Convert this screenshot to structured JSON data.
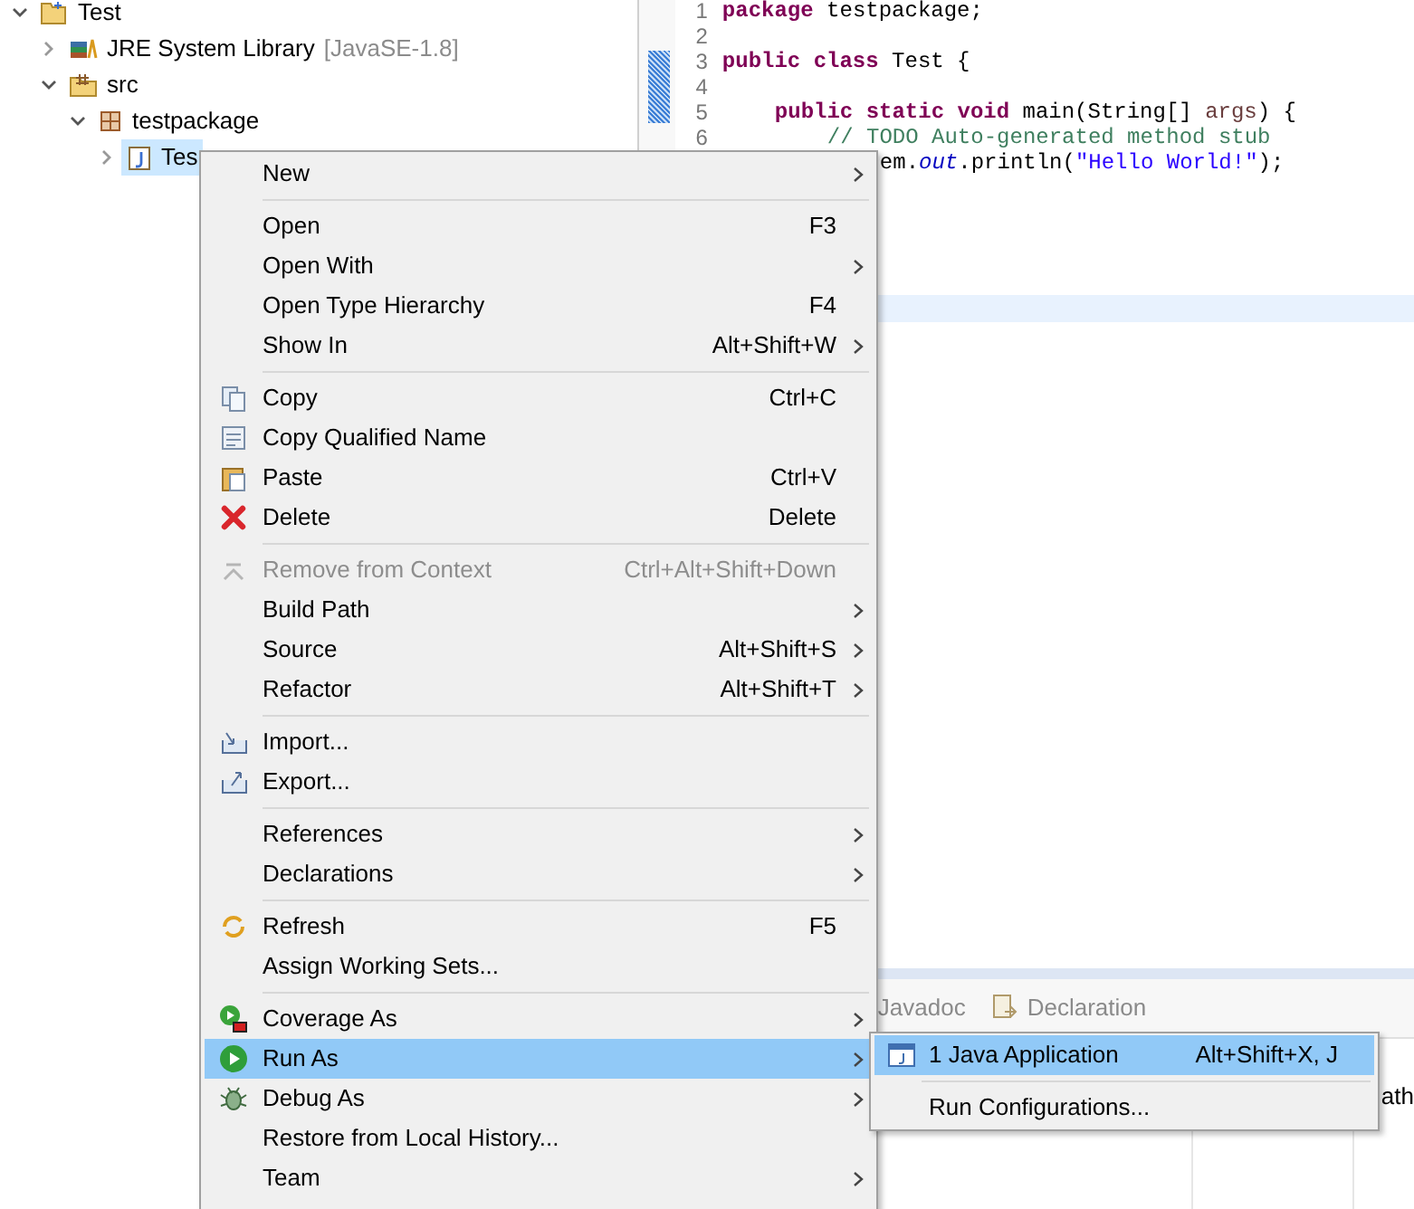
{
  "tree": [
    {
      "label": "Test",
      "expanded": true,
      "selected": false,
      "children": [
        {
          "label": "JRE System Library",
          "suffix": "[JavaSE-1.8]",
          "expanded": false,
          "selected": false
        },
        {
          "label": "src",
          "expanded": true,
          "selected": false,
          "children": [
            {
              "label": "testpackage",
              "expanded": true,
              "selected": false,
              "children": [
                {
                  "label": "Tes",
                  "expanded": false,
                  "selected": true
                }
              ]
            }
          ]
        }
      ]
    }
  ],
  "editor": {
    "lines": [
      {
        "number": "1",
        "kind": "top",
        "tokens": [
          {
            "kind": "keyword",
            "text": "package"
          },
          {
            "kind": "plain",
            "text": " testpackage;"
          }
        ]
      },
      {
        "number": "2",
        "kind": "top"
      },
      {
        "number": "3",
        "kind": "top",
        "tokens": [
          {
            "kind": "keyword",
            "text": "public class"
          },
          {
            "kind": "plain",
            "text": " Test {"
          }
        ]
      },
      {
        "number": "4",
        "kind": "top"
      },
      {
        "number": "5",
        "kind": "member",
        "tokens": [
          {
            "kind": "keyword",
            "text": "public static void"
          },
          {
            "kind": "plain",
            "text": " main(String[] "
          },
          {
            "kind": "param",
            "text": "args"
          },
          {
            "kind": "plain",
            "text": ") {"
          }
        ]
      },
      {
        "number": "6",
        "kind": "body",
        "tokens": [
          {
            "kind": "comment",
            "text": "// TODO Auto-generated method stub"
          }
        ]
      },
      {
        "kind": "covered",
        "tokens": [
          {
            "kind": "plain",
            "text": "em."
          },
          {
            "kind": "static",
            "text": "out"
          },
          {
            "kind": "plain",
            "text": ".println("
          },
          {
            "kind": "string",
            "text": "\"Hello World!\""
          },
          {
            "kind": "plain",
            "text": ");"
          }
        ]
      }
    ]
  },
  "bottom_panel": {
    "tabs": [
      {
        "label": "Javadoc",
        "selected": false
      },
      {
        "label": "Declaration",
        "selected": false
      }
    ],
    "column_3": "ath"
  },
  "context_menu": {
    "groups": [
      [
        {
          "label": "New",
          "submenu": true,
          "disabled": false,
          "selected": false
        }
      ],
      [
        {
          "label": "Open",
          "shortcut": "F3",
          "submenu": false,
          "disabled": false,
          "selected": false
        },
        {
          "label": "Open With",
          "submenu": true,
          "disabled": false,
          "selected": false
        },
        {
          "label": "Open Type Hierarchy",
          "shortcut": "F4",
          "submenu": false,
          "disabled": false,
          "selected": false
        },
        {
          "label": "Show In",
          "shortcut": "Alt+Shift+W",
          "submenu": true,
          "disabled": false,
          "selected": false
        }
      ],
      [
        {
          "label": "Copy",
          "shortcut": "Ctrl+C",
          "submenu": false,
          "disabled": false,
          "selected": false
        },
        {
          "label": "Copy Qualified Name",
          "submenu": false,
          "disabled": false,
          "selected": false
        },
        {
          "label": "Paste",
          "shortcut": "Ctrl+V",
          "submenu": false,
          "disabled": false,
          "selected": false
        },
        {
          "label": "Delete",
          "shortcut": "Delete",
          "submenu": false,
          "disabled": false,
          "selected": false
        }
      ],
      [
        {
          "label": "Remove from Context",
          "shortcut": "Ctrl+Alt+Shift+Down",
          "submenu": false,
          "disabled": true,
          "selected": false
        },
        {
          "label": "Build Path",
          "submenu": true,
          "disabled": false,
          "selected": false
        },
        {
          "label": "Source",
          "shortcut": "Alt+Shift+S",
          "submenu": true,
          "disabled": false,
          "selected": false
        },
        {
          "label": "Refactor",
          "shortcut": "Alt+Shift+T",
          "submenu": true,
          "disabled": false,
          "selected": false
        }
      ],
      [
        {
          "label": "Import...",
          "submenu": false,
          "disabled": false,
          "selected": false
        },
        {
          "label": "Export...",
          "submenu": false,
          "disabled": false,
          "selected": false
        }
      ],
      [
        {
          "label": "References",
          "submenu": true,
          "disabled": false,
          "selected": false
        },
        {
          "label": "Declarations",
          "submenu": true,
          "disabled": false,
          "selected": false
        }
      ],
      [
        {
          "label": "Refresh",
          "shortcut": "F5",
          "submenu": false,
          "disabled": false,
          "selected": false
        },
        {
          "label": "Assign Working Sets...",
          "submenu": false,
          "disabled": false,
          "selected": false
        }
      ],
      [
        {
          "label": "Coverage As",
          "submenu": true,
          "disabled": false,
          "selected": false
        },
        {
          "label": "Run As",
          "submenu": true,
          "disabled": false,
          "selected": true
        },
        {
          "label": "Debug As",
          "submenu": true,
          "disabled": false,
          "selected": false
        },
        {
          "label": "Restore from Local History...",
          "submenu": false,
          "disabled": false,
          "selected": false
        },
        {
          "label": "Team",
          "submenu": true,
          "disabled": false,
          "selected": false
        }
      ]
    ]
  },
  "submenu": {
    "groups": [
      [
        {
          "label": "1 Java Application",
          "shortcut": "Alt+Shift+X, J",
          "selected": true
        }
      ],
      [
        {
          "label": "Run Configurations...",
          "selected": false
        }
      ]
    ]
  }
}
